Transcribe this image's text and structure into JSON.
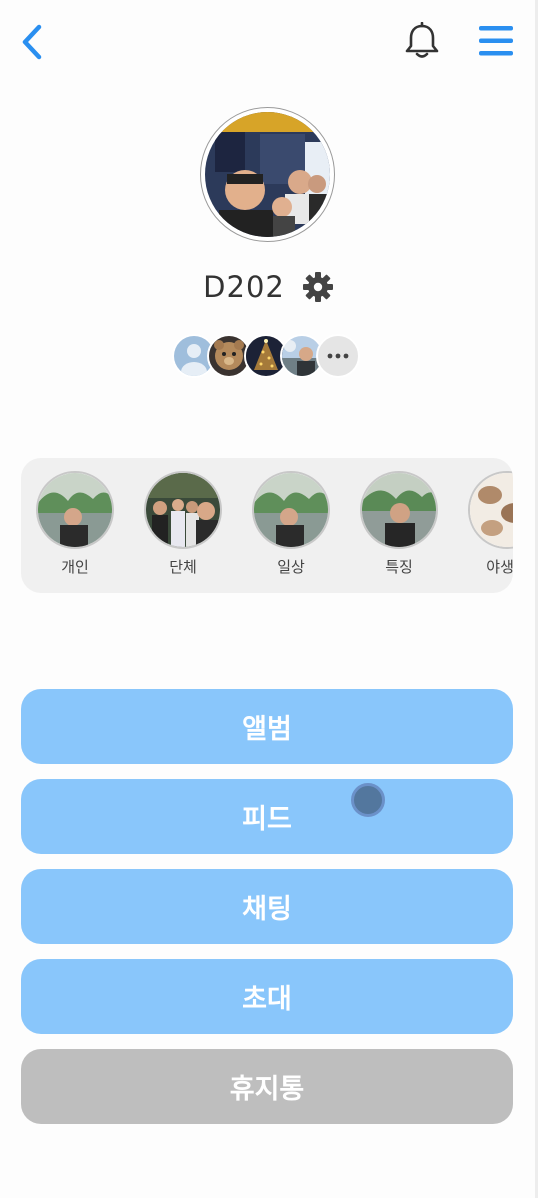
{
  "header": {
    "back_icon": "chevron-left-icon",
    "bell_icon": "bell-icon",
    "menu_icon": "hamburger-menu-icon",
    "accent_color": "#2a8ff0"
  },
  "group": {
    "name": "D202",
    "settings_icon": "gear-icon"
  },
  "members": {
    "avatars": [
      "default-user-avatar",
      "teddy-bear-avatar",
      "christmas-tree-avatar",
      "person-outdoor-avatar"
    ],
    "more_icon": "more-dots-icon"
  },
  "albums": [
    {
      "label": "개인"
    },
    {
      "label": "단체"
    },
    {
      "label": "일상"
    },
    {
      "label": "특징"
    },
    {
      "label": "야생동"
    }
  ],
  "actions": {
    "album": "앨범",
    "feed": "피드",
    "chat": "채팅",
    "invite": "초대",
    "trash": "휴지통"
  },
  "colors": {
    "action_blue": "#89c6fb",
    "action_gray": "#bebebe",
    "album_strip_bg": "#f0f0f0"
  }
}
